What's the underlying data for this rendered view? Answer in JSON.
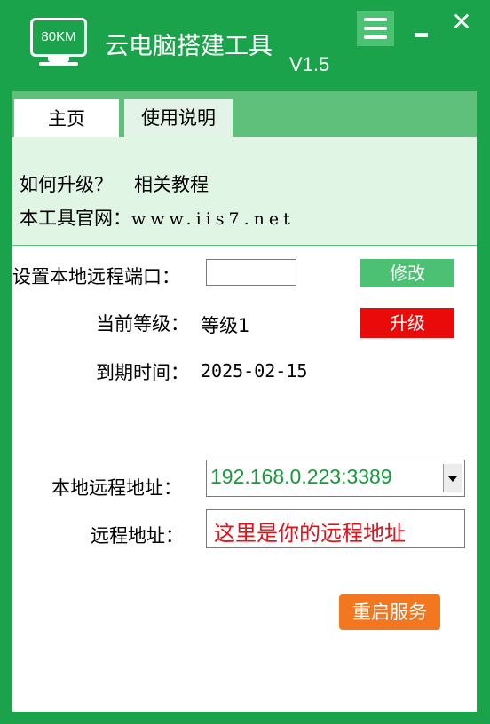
{
  "titlebar": {
    "logo_text": "80KM",
    "title": "云电脑搭建工具",
    "version": "V1.5",
    "close_glyph": "✕"
  },
  "tabs": [
    {
      "label": "主页",
      "active": true
    },
    {
      "label": "使用说明",
      "active": false
    }
  ],
  "info": {
    "line1_a": "如何升级？",
    "line1_b": "相关教程",
    "line2_label": "本工具官网：",
    "line2_url": "www.iis7.net"
  },
  "form": {
    "port_label": "设置本地远程端口：",
    "port_value": "",
    "modify_label": "修改",
    "level_label": "当前等级：",
    "level_value": "等级1",
    "upgrade_label": "升级",
    "expiry_label": "到期时间：",
    "expiry_value": "2025-02-15",
    "local_addr_label": "本地远程地址：",
    "local_addr_value": "192.168.0.223:3389",
    "remote_addr_label": "远程地址：",
    "remote_addr_value": "这里是你的远程地址",
    "restart_label": "重启服务"
  },
  "colors": {
    "brand_green": "#1aa34a",
    "light_green": "#e0f5e4",
    "button_green": "#4cc174",
    "upgrade_red": "#ea0a0a",
    "restart_orange": "#f37721",
    "address_green": "#189a3e",
    "remote_red": "#e0121a"
  },
  "icons": {
    "logo": "monitor-icon",
    "menu": "hamburger-menu-icon",
    "minimize": "minimize-icon",
    "close": "close-icon",
    "dropdown": "chevron-down-icon"
  }
}
